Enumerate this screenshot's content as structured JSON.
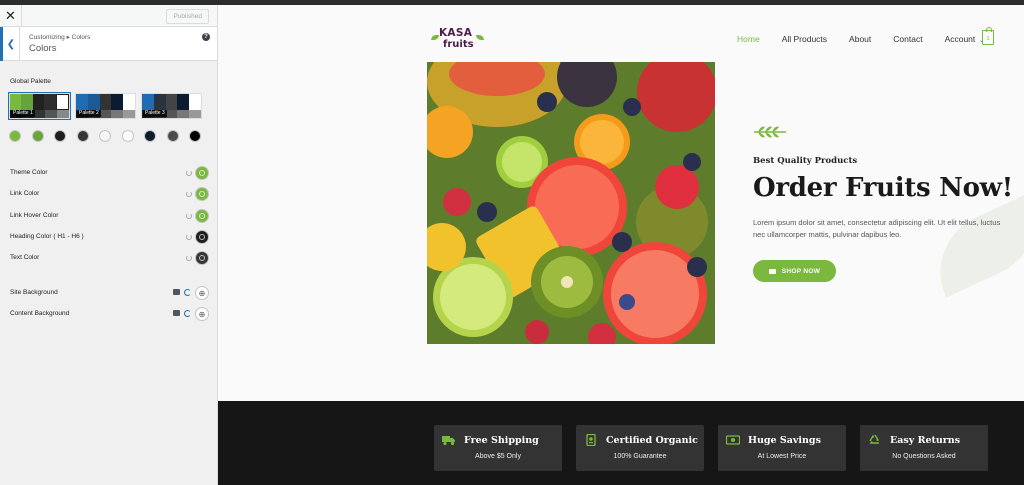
{
  "sidebar": {
    "published_label": "Published",
    "breadcrumb": "Customizing ▸ Colors",
    "section_title": "Colors",
    "global_palette_label": "Global Palette",
    "palettes": [
      {
        "name": "Palette 1",
        "colors": [
          "#7bb93e",
          "#66a33a",
          "#222222",
          "#2e2e2e",
          "#ffffff"
        ]
      },
      {
        "name": "Palette 2",
        "colors": [
          "#1f6cb4",
          "#1c5a96",
          "#1e2a3a",
          "#0b1b30",
          "#ffffff"
        ]
      },
      {
        "name": "Palette 3",
        "colors": [
          "#1f6cb4",
          "#2a3440",
          "#1e2a3a",
          "#0b1b30",
          "#ffffff"
        ]
      }
    ],
    "palette_colors": [
      "#7bb93e",
      "#6aa536",
      "#1e1e1e",
      "#353535",
      "#f7f7f7",
      "#ffffff",
      "#0c1e2b",
      "#4a4a4a",
      "#000000"
    ],
    "color_settings": [
      {
        "label": "Theme Color",
        "color": "#7bb93e"
      },
      {
        "label": "Link Color",
        "color": "#7bb93e"
      },
      {
        "label": "Link Hover Color",
        "color": "#7bb93e"
      },
      {
        "label": "Heading Color ( H1 - H6 )",
        "color": "#1e1e1e"
      },
      {
        "label": "Text Color",
        "color": "#353535"
      }
    ],
    "background_settings": [
      {
        "label": "Site Background"
      },
      {
        "label": "Content Background"
      }
    ]
  },
  "preview": {
    "logo_line1": "KASA",
    "logo_line2": "fruits",
    "nav": {
      "home": "Home",
      "all_products": "All Products",
      "about": "About",
      "contact": "Contact",
      "account": "Account"
    },
    "cart_count": "1",
    "hero": {
      "tagline": "Best Quality Products",
      "headline": "Order Fruits Now!",
      "body": "Lorem ipsum dolor sit amet, consectetur adipiscing elit. Ut elit tellus, luctus nec ullamcorper mattis, pulvinar dapibus leo.",
      "cta": "SHOP NOW"
    },
    "features": [
      {
        "title": "Free Shipping",
        "subtitle": "Above $5 Only",
        "icon": "truck-icon"
      },
      {
        "title": "Certified Organic",
        "subtitle": "100% Guarantee",
        "icon": "certificate-icon"
      },
      {
        "title": "Huge Savings",
        "subtitle": "At Lowest Price",
        "icon": "money-icon"
      },
      {
        "title": "Easy Returns",
        "subtitle": "No Questions Asked",
        "icon": "recycle-icon"
      }
    ],
    "accent_color": "#7bb93e"
  }
}
